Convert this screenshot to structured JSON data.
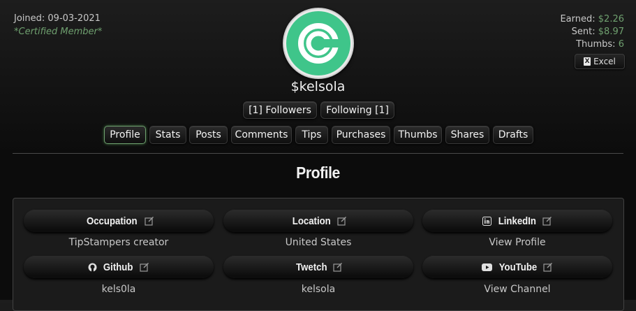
{
  "profile_meta": {
    "joined": "Joined: 09-03-2021",
    "badge": "*Certified Member*"
  },
  "stats": {
    "earned_label": "Earned:",
    "earned_value": "$2.26",
    "sent_label": "Sent:",
    "sent_value": "$8.97",
    "thumbs_label": "Thumbs:",
    "thumbs_value": "6"
  },
  "export": {
    "excel_label": "Excel",
    "icon": "excel-icon"
  },
  "user": {
    "username": "$kelsola",
    "avatar_icon": "tipstampers-logo"
  },
  "social": {
    "followers_label": "[1] Followers",
    "following_label": "Following [1]"
  },
  "tabs": [
    {
      "label": "Profile",
      "active": true
    },
    {
      "label": "Stats"
    },
    {
      "label": "Posts"
    },
    {
      "label": "Comments"
    },
    {
      "label": "Tips"
    },
    {
      "label": "Purchases"
    },
    {
      "label": "Thumbs"
    },
    {
      "label": "Shares"
    },
    {
      "label": "Drafts"
    }
  ],
  "section": {
    "title": "Profile"
  },
  "fields": [
    {
      "label": "Occupation",
      "value": "TipStampers creator",
      "icon": ""
    },
    {
      "label": "Location",
      "value": "United States",
      "icon": ""
    },
    {
      "label": "LinkedIn",
      "value": "View Profile",
      "icon": "linkedin-icon"
    },
    {
      "label": "Github",
      "value": "kels0la",
      "icon": "github-icon"
    },
    {
      "label": "Twetch",
      "value": "kelsola",
      "icon": ""
    },
    {
      "label": "YouTube",
      "value": "View Channel",
      "icon": "youtube-icon"
    }
  ],
  "colors": {
    "accent_green": "#6fa06f",
    "logo_green": "#3fc58a"
  }
}
